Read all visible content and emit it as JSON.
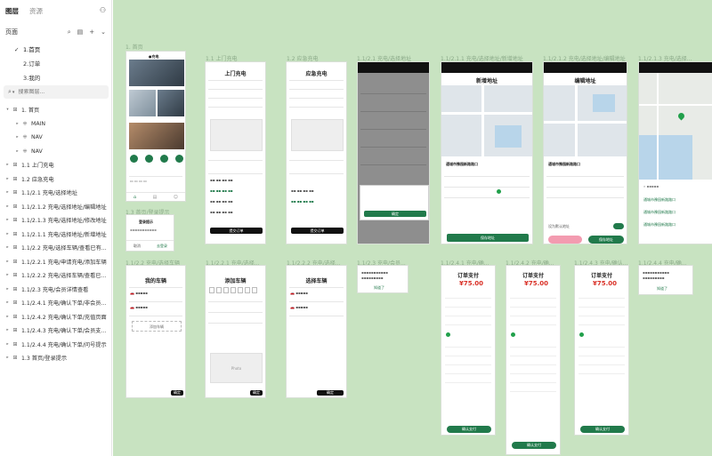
{
  "left_panel": {
    "tabs": [
      {
        "label": "图层",
        "active": true
      },
      {
        "label": "资源",
        "active": false
      }
    ],
    "pages_header": "页面",
    "pages": [
      {
        "label": "1.首页",
        "active": true
      },
      {
        "label": "2.订单",
        "active": false
      },
      {
        "label": "3.我的",
        "active": false
      }
    ],
    "search": {
      "placeholder": "搜索图层..."
    },
    "layers": [
      {
        "label": "1. 首页",
        "level": 0,
        "expanded": true,
        "icon": "frame-icon"
      },
      {
        "label": "MAIN",
        "level": 1,
        "expanded": false,
        "icon": "component-icon"
      },
      {
        "label": "NAV",
        "level": 1,
        "expanded": false,
        "icon": "component-icon"
      },
      {
        "label": "NAV",
        "level": 1,
        "expanded": false,
        "icon": "component-icon"
      },
      {
        "label": "1.1 上门充电",
        "level": 0,
        "expanded": false,
        "icon": "frame-icon"
      },
      {
        "label": "1.2 应急充电",
        "level": 0,
        "expanded": false,
        "icon": "frame-icon"
      },
      {
        "label": "1.1/2.1 充电/选择地址",
        "level": 0,
        "expanded": false,
        "icon": "frame-icon"
      },
      {
        "label": "1.1/2.1.2 充电/选择地址/编辑地址",
        "level": 0,
        "expanded": false,
        "icon": "frame-icon"
      },
      {
        "label": "1.1/2.1.3 充电/选择地址/修改地址",
        "level": 0,
        "expanded": false,
        "icon": "frame-icon"
      },
      {
        "label": "1.1/2.1.1 充电/选择地址/新增地址",
        "level": 0,
        "expanded": false,
        "icon": "frame-icon"
      },
      {
        "label": "1.1/2.2 充电/选择车辆/查看已有...",
        "level": 0,
        "expanded": false,
        "icon": "frame-icon"
      },
      {
        "label": "1.1/2.2.1 充电/申请充电/添加车辆",
        "level": 0,
        "expanded": false,
        "icon": "frame-icon"
      },
      {
        "label": "1.1/2.2.2 充电/选择车辆/查看已...",
        "level": 0,
        "expanded": false,
        "icon": "frame-icon"
      },
      {
        "label": "1.1/2.3 充电/会员详情查看",
        "level": 0,
        "expanded": false,
        "icon": "frame-icon"
      },
      {
        "label": "1.1/2.4.1 充电/确认下单/非会员...",
        "level": 0,
        "expanded": false,
        "icon": "frame-icon"
      },
      {
        "label": "1.1/2.4.2 充电/确认下单/充值页面",
        "level": 0,
        "expanded": false,
        "icon": "frame-icon"
      },
      {
        "label": "1.1/2.4.3 充电/确认下单/会员支...",
        "level": 0,
        "expanded": false,
        "icon": "frame-icon"
      },
      {
        "label": "1.1/2.4.4 充电/确认下单/问号提示",
        "level": 0,
        "expanded": false,
        "icon": "frame-icon"
      },
      {
        "label": "1.3 首页/登录提示",
        "level": 0,
        "expanded": false,
        "icon": "frame-icon"
      }
    ]
  },
  "canvas": {
    "background": "#c8e3c1",
    "accent_green": "#217a4b",
    "price_red": "#d93026",
    "artboard_labels": {
      "home": "1. 首页",
      "door": "1.1 上门充电",
      "emergency": "1.2 应急充电",
      "addr": "1.1/2.1 充电/选择地址",
      "addr_new": "1.1/2.1.1 充电/选择地址/新增地址",
      "addr_edit": "1.1/2.1.2 充电/选择地址/编辑地址",
      "addr_mod": "1.1/2.1.3 充电/选择...",
      "login": "1.3 首页/登录提示",
      "car_list": "1.1/2.2 充电/选择车辆",
      "car_add": "1.1/2.2.1 充电/选择...",
      "car_view": "1.1/2.2.2 充电/选择...",
      "member": "1.1/2.3 充电/会员...",
      "order1": "1.1/2.4.1 充电/确...",
      "order2": "1.1/2.4.2 充电/确...",
      "order3": "1.1/2.4.3 充电/确认...",
      "order4": "1.1/2.4.4 充电/确..."
    },
    "screens": {
      "door_title": "上门充电",
      "emergency_title": "应急充电",
      "add_addr_title": "新增地址",
      "edit_addr_title": "编辑地址",
      "car_list_title": "我的车辆",
      "car_add_title": "添加车辆",
      "car_select_title": "选择车辆",
      "order_title": "订单支付",
      "login_title": "登录提示",
      "login_cancel": "取消",
      "login_go": "去登录",
      "price": "¥75.00",
      "pay_btn": "确认支付",
      "save_btn": "保存地址",
      "confirm_btn": "确定",
      "submit_btn": "提交订单",
      "member_btn": "知道了",
      "add_car_btn": "添加车辆",
      "photo_label": "Photo",
      "addr_name": "通城市豫园新路路口",
      "set_default": "设为默认地址"
    }
  }
}
